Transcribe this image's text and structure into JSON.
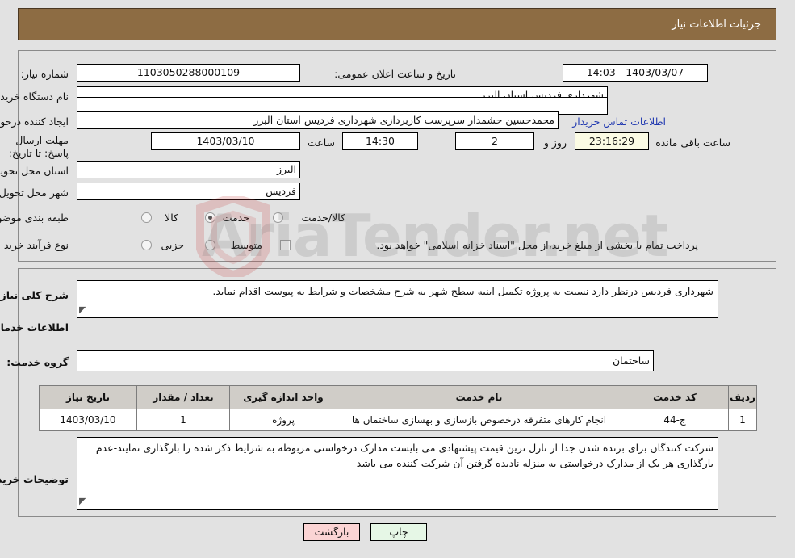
{
  "header": {
    "title": "جزئیات اطلاعات نیاز",
    "bar_color": "#8d6c43"
  },
  "form": {
    "need_number_label": "شماره نیاز:",
    "need_number_value": "1103050288000109",
    "announce_label": "تاریخ و ساعت اعلان عمومی:",
    "announce_value": "1403/03/07 - 14:03",
    "buyer_org_label": "نام دستگاه خریدار:",
    "buyer_org_value": "شهرداری فردیس استان البرز",
    "empty_field_value": "",
    "creator_label": "ایجاد کننده درخواست:",
    "creator_value": "محمدحسین حشمدار سرپرست کاربردازی شهرداری فردیس استان البرز",
    "contact_link": "اطلاعات تماس خریدار",
    "deadline_label": "مهلت ارسال پاسخ: تا تاریخ:",
    "deadline_date": "1403/03/10",
    "hour_label": "ساعت",
    "deadline_time": "14:30",
    "days_remaining": "2",
    "days_label": "روز و",
    "time_remaining": "23:16:29",
    "remaining_label": "ساعت باقی مانده",
    "province_label": "استان محل تحویل:",
    "province_value": "البرز",
    "city_label": "شهر محل تحویل:",
    "city_value": "فردیس",
    "category_label": "طبقه بندی موضوعی:",
    "category_options": [
      {
        "label": "کالا",
        "selected": false
      },
      {
        "label": "خدمت",
        "selected": true
      },
      {
        "label": "کالا/خدمت",
        "selected": false
      }
    ],
    "process_label": "نوع فرآیند خرید :",
    "process_options": [
      {
        "label": "جزیی",
        "selected": false
      },
      {
        "label": "متوسط",
        "selected": false
      }
    ],
    "treasury_checkbox_label": "پرداخت تمام یا بخشی از مبلغ خرید،از محل \"اسناد خزانه اسلامی\" خواهد بود.",
    "treasury_checked": false
  },
  "details": {
    "summary_label": "شرح کلی نیاز:",
    "summary_value": "شهرداری فردیس درنظر دارد نسبت به پروژه تکمیل ابنیه سطح شهر به شرح مشخصات و شرایط به پیوست اقدام نماید.",
    "services_heading": "اطلاعات خدمات مورد نیاز",
    "service_group_label": "گروه خدمت:",
    "service_group_value": "ساختمان"
  },
  "table": {
    "columns": [
      "ردیف",
      "کد خدمت",
      "نام خدمت",
      "واحد اندازه گیری",
      "تعداد / مقدار",
      "تاریخ نیاز"
    ],
    "rows": [
      {
        "index": "1",
        "code": "ج-44",
        "name": "انجام کارهای متفرقه درخصوص بازسازی و بهسازی ساختمان ها",
        "unit": "پروژه",
        "quantity": "1",
        "date": "1403/03/10"
      }
    ]
  },
  "notes": {
    "label": "توضیحات خریدار:",
    "value": "شرکت کنندگان برای برنده شدن جدا از نازل ترین قیمت پیشنهادی می بایست مدارک درخواستی مربوطه به شرایط ذکر شده را بارگذاری نمایند-عدم بارگذاری هر یک از مدارک درخواستی به منزله نادیده گرفتن آن شرکت کننده می باشد"
  },
  "buttons": {
    "print": "چاپ",
    "back": "بازگشت"
  },
  "watermark": {
    "text": "AriaTender.net"
  }
}
